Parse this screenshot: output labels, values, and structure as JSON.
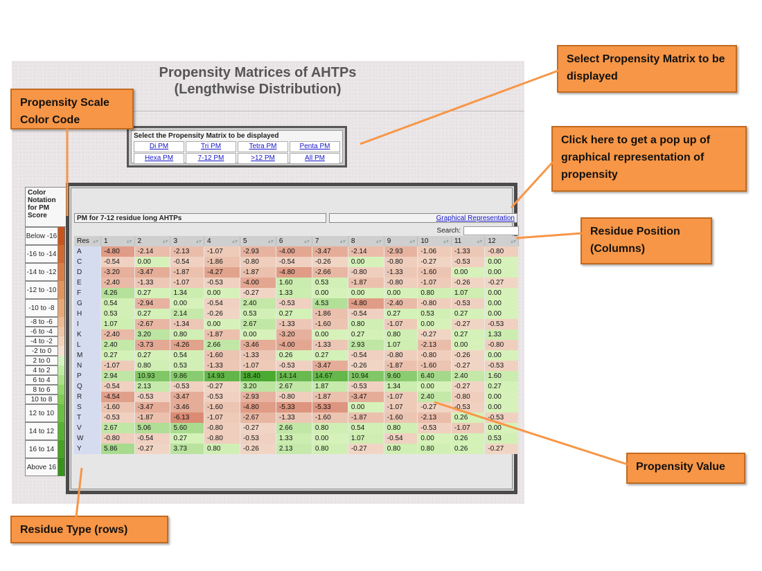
{
  "page_title_line1": "Propensity Matrices of AHTPs",
  "page_title_line2": "(Lengthwise Distribution)",
  "selector": {
    "heading": "Select the Propensity Matrix to be displayed",
    "row1": [
      "Di PM",
      "Tri PM",
      "Tetra PM",
      "Penta PM"
    ],
    "row2": [
      "Hexa PM",
      "7-12 PM",
      ">12 PM",
      "All PM"
    ]
  },
  "legend": {
    "heading": "Color Notation for PM Score",
    "labels": [
      "Below -16",
      "-16 to -14",
      "-14 to -12",
      "-12 to -10",
      "-10 to -8",
      "-8 to -6",
      "-6 to -4",
      "-4 to -2",
      "-2 to 0",
      "2 to 0",
      "4 to 2",
      "6 to 4",
      "8 to 6",
      "10 to 8",
      "12 to 10",
      "14 to 12",
      "16 to 14",
      "Above 16"
    ],
    "colors": [
      "#c8541c",
      "#d06a30",
      "#d87e46",
      "#e0945e",
      "#e6a878",
      "#ebb992",
      "#efc6a6",
      "#f2d3ba",
      "#f5e0d0",
      "#d4f2c0",
      "#bfeba3",
      "#a9e186",
      "#93d66c",
      "#7fcb55",
      "#6bbf43",
      "#58b133",
      "#47a226",
      "#37931b"
    ]
  },
  "panel": {
    "caption": "PM for 7-12 residue long AHTPs",
    "graph_link": "Graphical Representation",
    "search_label": "Search:"
  },
  "table": {
    "columns": [
      "Res",
      "1",
      "2",
      "3",
      "4",
      "5",
      "6",
      "7",
      "8",
      "9",
      "10",
      "11",
      "12"
    ],
    "rows": [
      [
        "A",
        "-4.80",
        "-2.14",
        "-2.13",
        "-1.07",
        "-2.93",
        "-4.00",
        "-3.47",
        "-2.14",
        "-2.93",
        "-1.06",
        "-1.33",
        "-0.80"
      ],
      [
        "C",
        "-0.54",
        "0.00",
        "-0.54",
        "-1.86",
        "-0.80",
        "-0.54",
        "-0.26",
        "0.00",
        "-0.80",
        "-0.27",
        "-0.53",
        "0.00"
      ],
      [
        "D",
        "-3.20",
        "-3.47",
        "-1.87",
        "-4.27",
        "-1.87",
        "-4.80",
        "-2.66",
        "-0.80",
        "-1.33",
        "-1.60",
        "0.00",
        "0.00"
      ],
      [
        "E",
        "-2.40",
        "-1.33",
        "-1.07",
        "-0.53",
        "-4.00",
        "1.60",
        "0.53",
        "-1.87",
        "-0.80",
        "-1.07",
        "-0.26",
        "-0.27"
      ],
      [
        "F",
        "4.26",
        "0.27",
        "1.34",
        "0.00",
        "-0.27",
        "1.33",
        "0.00",
        "0.00",
        "0.00",
        "0.80",
        "1.07",
        "0.00"
      ],
      [
        "G",
        "0.54",
        "-2.94",
        "0.00",
        "-0.54",
        "2.40",
        "-0.53",
        "4.53",
        "-4.80",
        "-2.40",
        "-0.80",
        "-0.53",
        "0.00"
      ],
      [
        "H",
        "0.53",
        "0.27",
        "2.14",
        "-0.26",
        "0.53",
        "0.27",
        "-1.86",
        "-0.54",
        "0.27",
        "0.53",
        "0.27",
        "0.00"
      ],
      [
        "I",
        "1.07",
        "-2.67",
        "-1.34",
        "0.00",
        "2.67",
        "-1.33",
        "-1.60",
        "0.80",
        "-1.07",
        "0.00",
        "-0.27",
        "-0.53"
      ],
      [
        "K",
        "-2.40",
        "3.20",
        "0.80",
        "-1.87",
        "0.00",
        "-3.20",
        "0.00",
        "0.27",
        "0.80",
        "-0.27",
        "0.27",
        "1.33"
      ],
      [
        "L",
        "2.40",
        "-3.73",
        "-4.26",
        "2.66",
        "-3.46",
        "-4.00",
        "-1.33",
        "2.93",
        "1.07",
        "-2.13",
        "0.00",
        "-0.80"
      ],
      [
        "M",
        "0.27",
        "0.27",
        "0.54",
        "-1.60",
        "-1.33",
        "0.26",
        "0.27",
        "-0.54",
        "-0.80",
        "-0.80",
        "-0.26",
        "0.00"
      ],
      [
        "N",
        "-1.07",
        "0.80",
        "0.53",
        "-1.33",
        "-1.07",
        "-0.53",
        "-3.47",
        "-0.26",
        "-1.87",
        "-1.60",
        "-0.27",
        "-0.53"
      ],
      [
        "P",
        "2.94",
        "10.93",
        "9.86",
        "14.93",
        "18.40",
        "14.14",
        "14.67",
        "10.94",
        "9.60",
        "6.40",
        "2.40",
        "1.60"
      ],
      [
        "Q",
        "-0.54",
        "2.13",
        "-0.53",
        "-0.27",
        "3.20",
        "2.67",
        "1.87",
        "-0.53",
        "1.34",
        "0.00",
        "-0.27",
        "0.27"
      ],
      [
        "R",
        "-4.54",
        "-0.53",
        "-3.47",
        "-0.53",
        "-2.93",
        "-0.80",
        "-1.87",
        "-3.47",
        "-1.07",
        "2.40",
        "-0.80",
        "0.00"
      ],
      [
        "S",
        "-1.60",
        "-3.47",
        "-3.46",
        "-1.60",
        "-4.80",
        "-5.33",
        "-5.33",
        "0.00",
        "-1.07",
        "-0.27",
        "-0.53",
        "0.00"
      ],
      [
        "T",
        "-0.53",
        "-1.87",
        "-6.13",
        "-1.07",
        "-2.67",
        "-1.33",
        "-1.60",
        "-1.87",
        "-1.60",
        "-2.13",
        "0.26",
        "-0.53"
      ],
      [
        "V",
        "2.67",
        "5.06",
        "5.60",
        "-0.80",
        "-0.27",
        "2.66",
        "0.80",
        "0.54",
        "0.80",
        "-0.53",
        "-1.07",
        "0.00"
      ],
      [
        "W",
        "-0.80",
        "-0.54",
        "0.27",
        "-0.80",
        "-0.53",
        "1.33",
        "0.00",
        "1.07",
        "-0.54",
        "0.00",
        "0.26",
        "0.53"
      ],
      [
        "Y",
        "5.86",
        "-0.27",
        "3.73",
        "0.80",
        "-0.26",
        "2.13",
        "0.80",
        "-0.27",
        "0.80",
        "0.80",
        "0.26",
        "-0.27"
      ]
    ]
  },
  "callouts": {
    "select_matrix": "Select Propensity Matrix to be displayed",
    "color_code": "Propensity Scale Color Code",
    "graphical": "Click here to get a pop up of graphical representation of propensity",
    "residue_position": "Residue Position (Columns)",
    "propensity_value": "Propensity Value",
    "residue_type": "Residue Type (rows)"
  }
}
